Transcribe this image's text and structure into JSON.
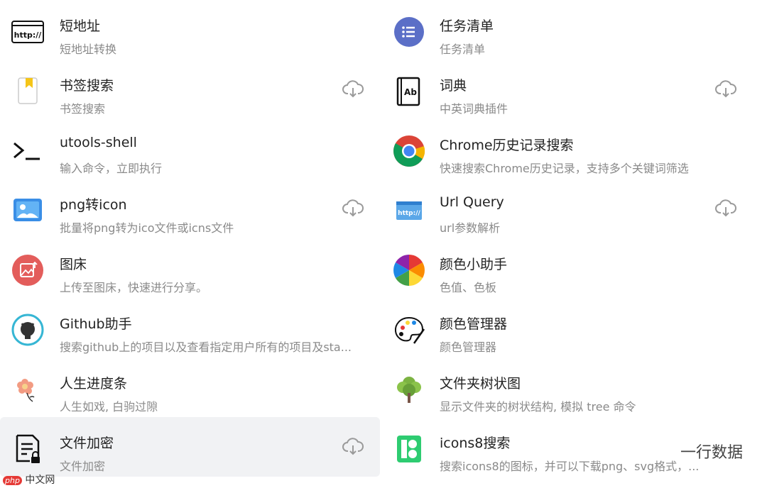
{
  "left_column": [
    {
      "title": "短地址",
      "desc": "短地址转换",
      "icon": "http-link-icon",
      "download": false
    },
    {
      "title": "书签搜索",
      "desc": "书签搜索",
      "icon": "bookmark-icon",
      "download": true
    },
    {
      "title": "utools-shell",
      "desc": "输入命令，立即执行",
      "icon": "terminal-icon",
      "download": false
    },
    {
      "title": "png转icon",
      "desc": "批量将png转为ico文件或icns文件",
      "icon": "image-icon",
      "download": true
    },
    {
      "title": "图床",
      "desc": "上传至图床，快速进行分享。",
      "icon": "image-upload-icon",
      "download": false
    },
    {
      "title": "Github助手",
      "desc": "搜索github上的项目以及查看指定用户所有的项目及sta...",
      "icon": "github-icon",
      "download": false
    },
    {
      "title": "人生进度条",
      "desc": "人生如戏, 白驹过隙",
      "icon": "flower-icon",
      "download": false
    },
    {
      "title": "文件加密",
      "desc": "文件加密",
      "icon": "file-lock-icon",
      "download": true,
      "selected": true
    }
  ],
  "right_column": [
    {
      "title": "任务清单",
      "desc": "任务清单",
      "icon": "task-list-icon",
      "download": false
    },
    {
      "title": "词典",
      "desc": "中英词典插件",
      "icon": "dictionary-icon",
      "download": true
    },
    {
      "title": "Chrome历史记录搜索",
      "desc": "快速搜索Chrome历史记录，支持多个关键词筛选",
      "icon": "chrome-icon",
      "download": false
    },
    {
      "title": "Url Query",
      "desc": "url参数解析",
      "icon": "url-query-icon",
      "download": true
    },
    {
      "title": "颜色小助手",
      "desc": "色值、色板",
      "icon": "color-wheel-icon",
      "download": false
    },
    {
      "title": "颜色管理器",
      "desc": "颜色管理器",
      "icon": "palette-icon",
      "download": false
    },
    {
      "title": "文件夹树状图",
      "desc": "显示文件夹的树状结构, 模拟 tree 命令",
      "icon": "tree-icon",
      "download": false
    },
    {
      "title": "icons8搜索",
      "desc": "搜索icons8的图标，并可以下载png、svg格式，...",
      "icon": "icons8-icon",
      "download": false
    }
  ],
  "watermarks": {
    "php_badge": "php",
    "php_text": "中文网",
    "wechat_text": "一行数据"
  },
  "colors": {
    "selected_bg": "#f1f2f4",
    "title": "#222222",
    "desc": "#8a8a8a",
    "download_icon": "#9a9a9a"
  }
}
